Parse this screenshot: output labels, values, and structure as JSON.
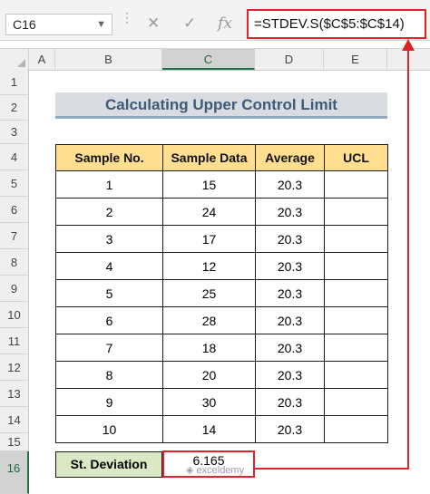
{
  "formula_bar": {
    "name_box": "C16",
    "cancel_icon": "✕",
    "enter_icon": "✓",
    "fx_icon": "fx",
    "formula": "=STDEV.S($C$5:$C$14)"
  },
  "columns": [
    "A",
    "B",
    "C",
    "D",
    "E"
  ],
  "selected_column": "C",
  "rows": [
    "1",
    "2",
    "3",
    "4",
    "5",
    "6",
    "7",
    "8",
    "9",
    "10",
    "11",
    "12",
    "13",
    "14",
    "15",
    "16"
  ],
  "selected_row": "16",
  "title": "Calculating Upper Control Limit",
  "table": {
    "headers": [
      "Sample No.",
      "Sample Data",
      "Average",
      "UCL"
    ],
    "rows": [
      [
        "1",
        "15",
        "20.3",
        ""
      ],
      [
        "2",
        "24",
        "20.3",
        ""
      ],
      [
        "3",
        "17",
        "20.3",
        ""
      ],
      [
        "4",
        "12",
        "20.3",
        ""
      ],
      [
        "5",
        "25",
        "20.3",
        ""
      ],
      [
        "6",
        "28",
        "20.3",
        ""
      ],
      [
        "7",
        "18",
        "20.3",
        ""
      ],
      [
        "8",
        "20",
        "20.3",
        ""
      ],
      [
        "9",
        "30",
        "20.3",
        ""
      ],
      [
        "10",
        "14",
        "20.3",
        ""
      ]
    ]
  },
  "std_dev": {
    "label": "St. Deviation",
    "value": "6.165"
  },
  "watermark": "exceldemy",
  "colors": {
    "highlight_red": "#e0232a",
    "header_yellow": "#ffdf8f",
    "label_green": "#d9e9c4",
    "title_blue": "#3d5a78"
  }
}
